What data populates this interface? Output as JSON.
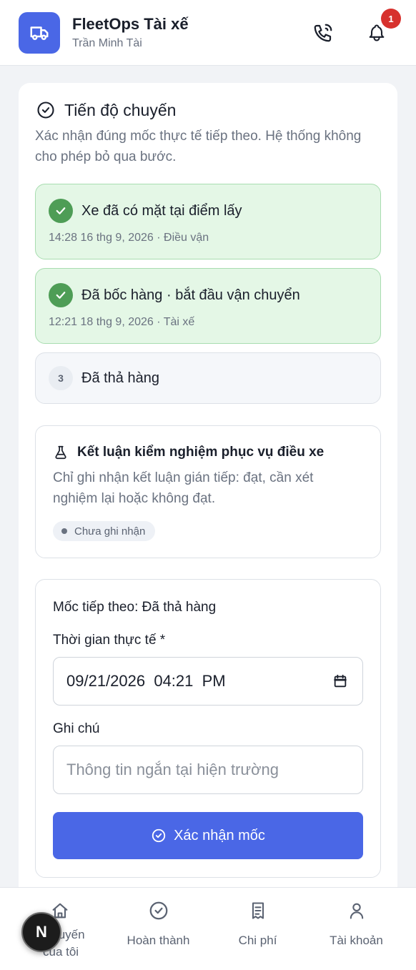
{
  "header": {
    "title": "FleetOps Tài xế",
    "subtitle": "Trần Minh Tài",
    "notification_count": "1"
  },
  "progress": {
    "title": "Tiến độ chuyến",
    "description": "Xác nhận đúng mốc thực tế tiếp theo. Hệ thống không cho phép bỏ qua bước.",
    "steps": [
      {
        "status": "done",
        "label": "Xe đã có mặt tại điểm lấy",
        "meta": "14:28 16 thg 9, 2026 · Điều vận"
      },
      {
        "status": "done",
        "label": "Đã bốc hàng · bắt đầu vận chuyển",
        "meta": "12:21 18 thg 9, 2026 · Tài xế"
      },
      {
        "status": "pending",
        "number": "3",
        "label": "Đã thả hàng"
      }
    ]
  },
  "lab": {
    "title": "Kết luận kiểm nghiệm phục vụ điều xe",
    "description": "Chỉ ghi nhận kết luận gián tiếp: đạt, cần xét nghiệm lại hoặc không đạt.",
    "status": "Chưa ghi nhận"
  },
  "form": {
    "next_milestone": "Mốc tiếp theo: Đã thả hàng",
    "time_label": "Thời gian thực tế *",
    "time_value": "09/21/2026  04:21  PM",
    "note_label": "Ghi chú",
    "note_placeholder": "Thông tin ngắn tại hiện trường",
    "submit_label": "Xác nhận mốc"
  },
  "bottom_nav": {
    "items": [
      {
        "label": "Chuyến của tôi",
        "icon": "home-icon"
      },
      {
        "label": "Hoàn thành",
        "icon": "check-circle-icon"
      },
      {
        "label": "Chi phí",
        "icon": "receipt-icon"
      },
      {
        "label": "Tài khoản",
        "icon": "user-icon"
      }
    ]
  },
  "fab": {
    "letter": "N"
  },
  "colors": {
    "accent": "#4a67e6",
    "success": "#4e9d56",
    "success_bg": "#e4f7e6",
    "badge": "#d7312d"
  }
}
